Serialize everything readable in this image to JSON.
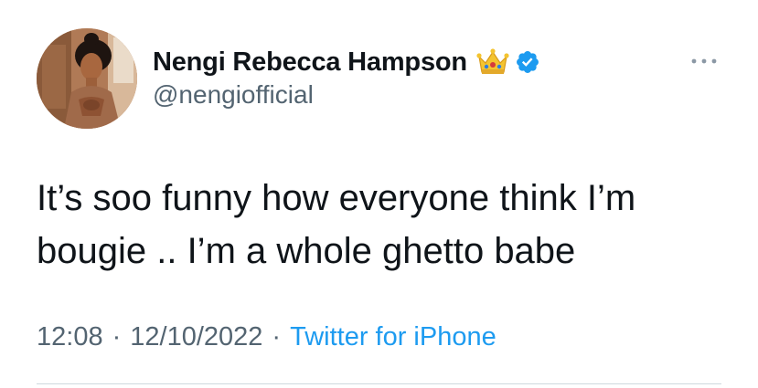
{
  "author": {
    "display_name": "Nengi Rebecca Hampson",
    "handle": "@nengiofficial",
    "name_emoji_icon": "crown-icon",
    "verified": true,
    "verified_color": "#1d9bf0"
  },
  "tweet": {
    "text": "It’s soo funny how everyone think I’m\nbougie .. I’m a whole ghetto babe",
    "time": "12:08",
    "date": "12/10/2022",
    "separator": "·",
    "source": "Twitter for iPhone"
  },
  "more_menu": {
    "icon": "more-dots-icon"
  },
  "colors": {
    "text_primary": "#0f1419",
    "text_secondary": "#536471",
    "link": "#1d9bf0",
    "divider": "#cfd9de",
    "background": "#ffffff"
  }
}
